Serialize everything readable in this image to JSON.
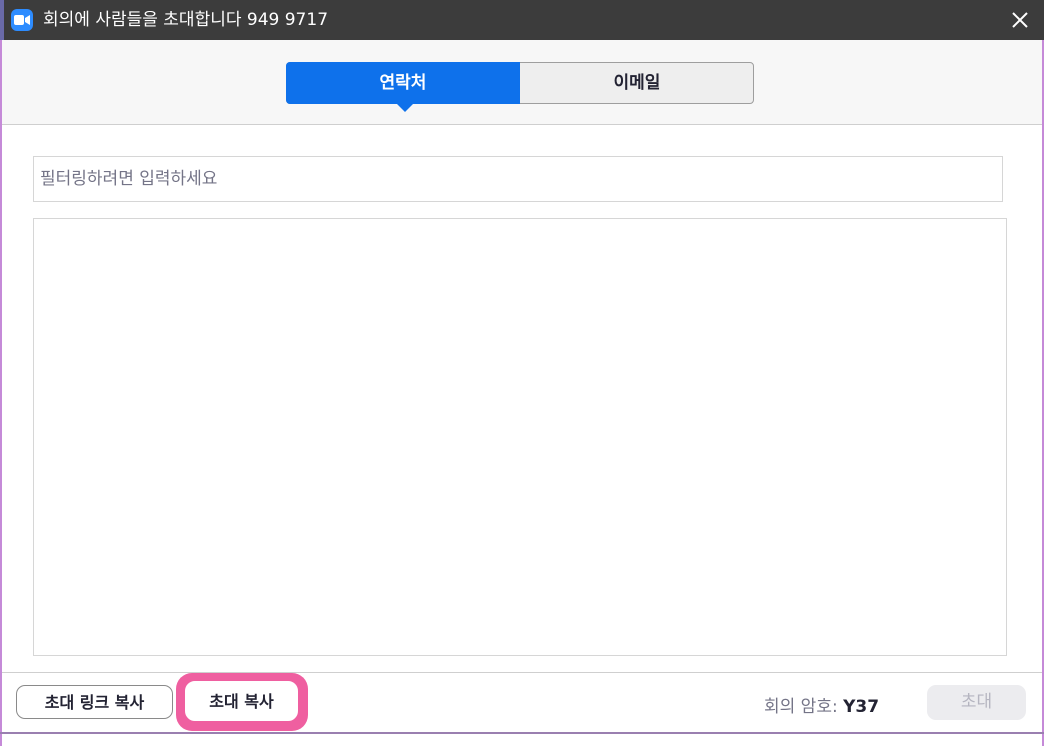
{
  "window": {
    "title": "회의에 사람들을 초대합니다 949 9717",
    "app_icon": "zoom-camera-icon",
    "close_icon": "close-icon"
  },
  "tabs": [
    {
      "label": "연락처",
      "selected": true
    },
    {
      "label": "이메일",
      "selected": false
    }
  ],
  "filter": {
    "placeholder": "필터링하려면 입력하세요",
    "value": ""
  },
  "contacts": [],
  "footer": {
    "copy_link_label": "초대 링크 복사",
    "copy_invitation_label": "초대 복사",
    "passcode_label": "회의 암호:",
    "passcode_value": "Y37",
    "invite_label": "초대"
  },
  "colors": {
    "accent": "#0e71eb",
    "title_bar": "#3c3c3c",
    "highlight": "#ef5fa0",
    "disabled_text": "#b5b5c0"
  }
}
